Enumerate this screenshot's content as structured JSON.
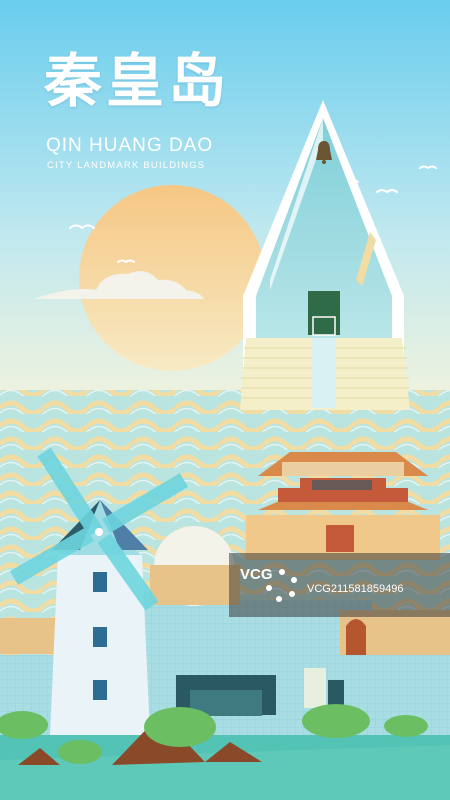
{
  "title_cn": "秦皇岛",
  "title_en": "QIN HUANG DAO",
  "subtitle": "CITY LANDMARK BUILDINGS",
  "watermark": {
    "logo": "VCG",
    "id": "VCG211581859496"
  },
  "colors": {
    "sky_top": "#69cdee",
    "sky_bottom": "#f5f4dc",
    "sun": "#f6c784",
    "sea_teal": "#a8dcd8",
    "sea_sand": "#f1dca3",
    "wall": "#a7d3e2",
    "roof": "#d98a4a",
    "grass": "#6bbf62",
    "ground": "#52c3b4"
  },
  "icons": [
    "bell-icon",
    "gull-icon",
    "windmill-icon",
    "camera-lens-icon"
  ]
}
